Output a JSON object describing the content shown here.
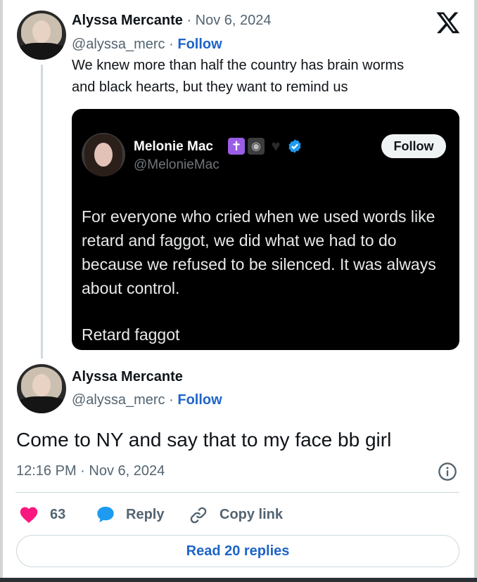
{
  "platform_logo": "x-logo",
  "tweet": {
    "author_name": "Alyssa Mercante",
    "separator": "·",
    "date": "Nov 6, 2024",
    "handle": "@alyssa_merc",
    "follow_label": "Follow",
    "text_line1": "We knew more than half the country has brain worms",
    "text_line2": "and black hearts, but they want to remind us"
  },
  "quote": {
    "author_name": "Melonie Mac",
    "emojis": [
      "cross-emoji",
      "game-controller-emoji",
      "black-heart-emoji"
    ],
    "verified": "verified-badge-icon",
    "handle": "@MelonieMac",
    "follow_label": "Follow",
    "text_lines": [
      "For everyone who cried when we used words like",
      "retard and faggot, we did what we had to do",
      "because we refused to be silenced. It was always",
      "about control."
    ],
    "text_last": "Retard faggot"
  },
  "reply": {
    "author_name": "Alyssa Mercante",
    "handle": "@alyssa_merc",
    "separator": "·",
    "follow_label": "Follow",
    "text": "Come to NY and say that to my face bb girl",
    "time": "12:16 PM · Nov 6, 2024",
    "info_icon": "info-icon"
  },
  "actions": {
    "like_count": "63",
    "reply_label": "Reply",
    "copy_label": "Copy link",
    "read_replies_label": "Read 20 replies"
  },
  "colors": {
    "like": "#f91880",
    "reply_icon": "#1d9bf0",
    "link": "#1d64c8",
    "muted": "#536471"
  }
}
